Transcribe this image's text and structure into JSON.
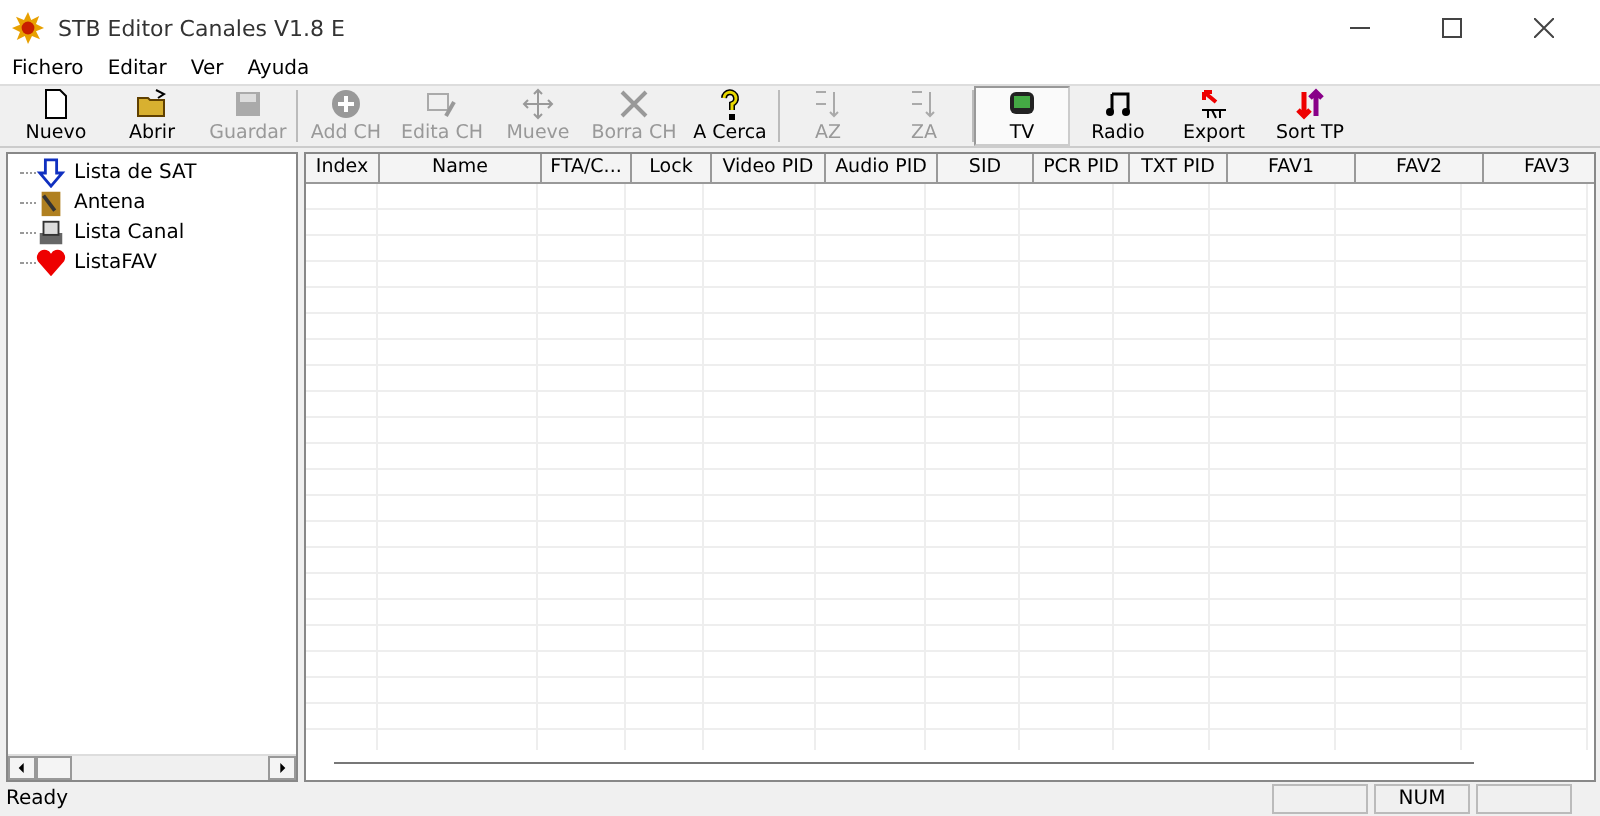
{
  "window": {
    "title": "STB Editor Canales V1.8 E"
  },
  "menu": [
    "Fichero",
    "Editar",
    "Ver",
    "Ayuda"
  ],
  "toolbar": [
    {
      "label": "Nuevo",
      "disabled": false,
      "selected": false
    },
    {
      "label": "Abrir",
      "disabled": false,
      "selected": false
    },
    {
      "label": "Guardar",
      "disabled": true,
      "selected": false
    },
    {
      "label": "Add CH",
      "disabled": true,
      "selected": false
    },
    {
      "label": "Edita CH",
      "disabled": true,
      "selected": false
    },
    {
      "label": "Mueve",
      "disabled": true,
      "selected": false
    },
    {
      "label": "Borra CH",
      "disabled": true,
      "selected": false
    },
    {
      "label": "A Cerca",
      "disabled": false,
      "selected": false
    },
    {
      "label": "AZ",
      "disabled": true,
      "selected": false
    },
    {
      "label": "ZA",
      "disabled": true,
      "selected": false
    },
    {
      "label": "TV",
      "disabled": false,
      "selected": true
    },
    {
      "label": "Radio",
      "disabled": false,
      "selected": false
    },
    {
      "label": "Export",
      "disabled": false,
      "selected": false
    },
    {
      "label": "Sort TP",
      "disabled": false,
      "selected": false
    }
  ],
  "tree": {
    "items": [
      {
        "label": "Lista de SAT"
      },
      {
        "label": "Antena"
      },
      {
        "label": "Lista Canal"
      },
      {
        "label": "ListaFAV"
      }
    ]
  },
  "table": {
    "columns": [
      "Index",
      "Name",
      "FTA/C...",
      "Lock",
      "Video PID",
      "Audio PID",
      "SID",
      "PCR PID",
      "TXT PID",
      "FAV1",
      "FAV2",
      "FAV3"
    ]
  },
  "status_bar": {
    "message": "Ready",
    "indicator": "NUM"
  }
}
